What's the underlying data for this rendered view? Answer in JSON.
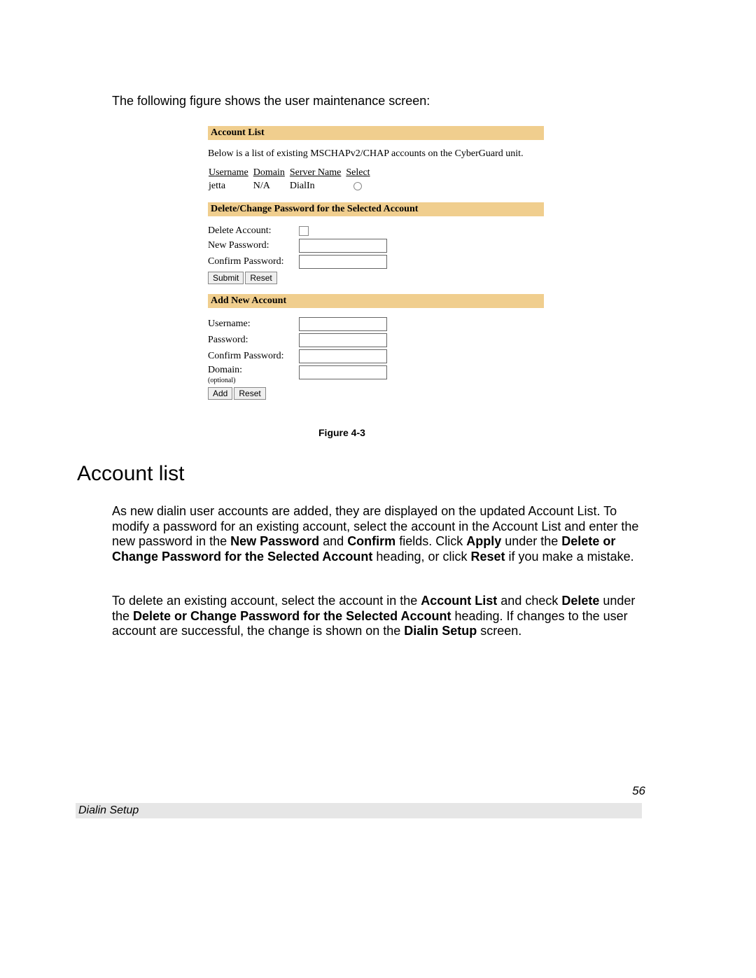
{
  "intro": "The following figure shows the user maintenance screen:",
  "figure": {
    "section1_title": "Account List",
    "section1_desc": "Below is a list of existing MSCHAPv2/CHAP accounts on the CyberGuard unit.",
    "table": {
      "headers": [
        "Username",
        "Domain",
        "Server Name",
        "Select"
      ],
      "row": {
        "username": "jetta",
        "domain": "N/A",
        "server": "DialIn"
      }
    },
    "section2_title": "Delete/Change Password for the Selected Account",
    "delete_account_label": "Delete Account:",
    "new_password_label": "New Password:",
    "confirm_password_label": "Confirm Password:",
    "submit_label": "Submit",
    "reset_label": "Reset",
    "section3_title": "Add New Account",
    "username_label": "Username:",
    "password_label": "Password:",
    "confirm_password_label2": "Confirm Password:",
    "domain_label": "Domain:",
    "domain_optional": "(optional)",
    "add_label": "Add",
    "reset_label2": "Reset"
  },
  "caption": "Figure 4-3",
  "section_heading": "Account list",
  "para1": {
    "t1": "As new dialin user accounts are added, they are displayed on the updated Account List. To modify a password for an existing account, select the account in the Account List and enter the new password in the ",
    "b1": "New Password",
    "t2": " and ",
    "b2": "Confirm",
    "t3": " fields.  Click ",
    "b3": "Apply",
    "t4": " under the ",
    "b4": "Delete or Change Password for the Selected Account",
    "t5": " heading, or click ",
    "b5": "Reset",
    "t6": " if you make a mistake."
  },
  "para2": {
    "t1": "To delete an existing account, select the account in the ",
    "b1": "Account List",
    "t2": " and check ",
    "b2": "Delete",
    "t3": " under the ",
    "b3": "Delete or Change Password for the Selected Account",
    "t4": " heading.  If changes to the user account are successful, the change is shown on the ",
    "b4": "Dialin Setup",
    "t5": " screen."
  },
  "footer": "Dialin Setup",
  "page_number": "56"
}
